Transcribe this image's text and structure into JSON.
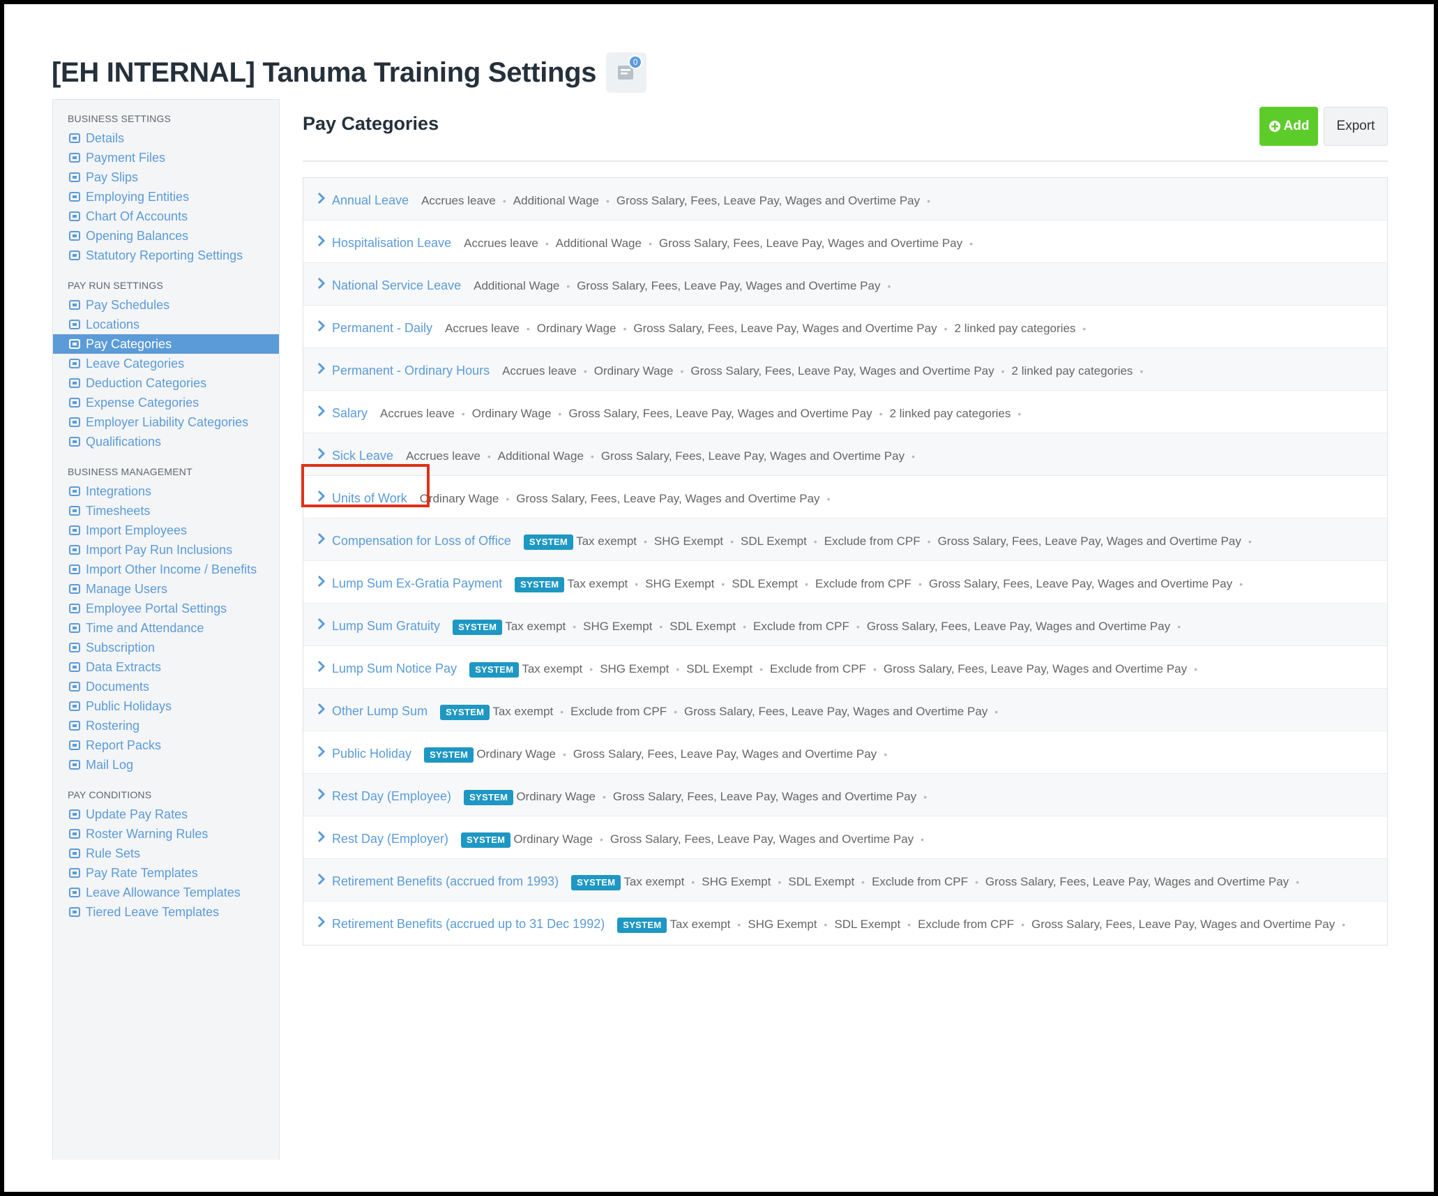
{
  "page": {
    "title": "[EH INTERNAL] Tanuma Training Settings",
    "notes_count": "0"
  },
  "sidebar": {
    "sections": [
      {
        "heading": "BUSINESS SETTINGS",
        "items": [
          {
            "label": "Details",
            "icon": "gear-icon"
          },
          {
            "label": "Payment Files",
            "icon": "floppy-icon"
          },
          {
            "label": "Pay Slips",
            "icon": "file-icon"
          },
          {
            "label": "Employing Entities",
            "icon": "bank-icon"
          },
          {
            "label": "Chart Of Accounts",
            "icon": "list-icon"
          },
          {
            "label": "Opening Balances",
            "icon": "leaf-icon"
          },
          {
            "label": "Statutory Reporting Settings",
            "icon": "lifebuoy-icon"
          }
        ]
      },
      {
        "heading": "PAY RUN SETTINGS",
        "items": [
          {
            "label": "Pay Schedules",
            "icon": "calendar-icon"
          },
          {
            "label": "Locations",
            "icon": "globe-icon"
          },
          {
            "label": "Pay Categories",
            "icon": "money-icon",
            "active": true
          },
          {
            "label": "Leave Categories",
            "icon": "plane-icon"
          },
          {
            "label": "Deduction Categories",
            "icon": "minus-circle-icon"
          },
          {
            "label": "Expense Categories",
            "icon": "archive-icon"
          },
          {
            "label": "Employer Liability Categories",
            "icon": "bar-chart-icon"
          },
          {
            "label": "Qualifications",
            "icon": "check-icon"
          }
        ]
      },
      {
        "heading": "BUSINESS MANAGEMENT",
        "items": [
          {
            "label": "Integrations",
            "icon": "integrations-icon"
          },
          {
            "label": "Timesheets",
            "icon": "clock-icon"
          },
          {
            "label": "Import Employees",
            "icon": "users-icon"
          },
          {
            "label": "Import Pay Run Inclusions",
            "icon": "refresh-icon"
          },
          {
            "label": "Import Other Income / Benefits",
            "icon": "hand-money-icon"
          },
          {
            "label": "Manage Users",
            "icon": "lock-icon"
          },
          {
            "label": "Employee Portal Settings",
            "icon": "wand-icon"
          },
          {
            "label": "Time and Attendance",
            "icon": "user-clock-icon"
          },
          {
            "label": "Subscription",
            "icon": "credit-card-icon"
          },
          {
            "label": "Data Extracts",
            "icon": "cloud-download-icon"
          },
          {
            "label": "Documents",
            "icon": "folder-icon"
          },
          {
            "label": "Public Holidays",
            "icon": "calendar-icon"
          },
          {
            "label": "Rostering",
            "icon": "calendar-icon"
          },
          {
            "label": "Report Packs",
            "icon": "folder-open-icon"
          },
          {
            "label": "Mail Log",
            "icon": "envelope-icon"
          }
        ]
      },
      {
        "heading": "PAY CONDITIONS",
        "items": [
          {
            "label": "Update Pay Rates",
            "icon": "hand-coins-icon"
          },
          {
            "label": "Roster Warning Rules",
            "icon": "calendar-warning-icon"
          },
          {
            "label": "Rule Sets",
            "icon": "gavel-icon"
          },
          {
            "label": "Pay Rate Templates",
            "icon": "money-icon"
          },
          {
            "label": "Leave Allowance Templates",
            "icon": "plane-icon"
          },
          {
            "label": "Tiered Leave Templates",
            "icon": "plane-icon"
          }
        ]
      }
    ]
  },
  "main": {
    "title": "Pay Categories",
    "add_label": "Add",
    "export_label": "Export",
    "system_badge": "SYSTEM",
    "categories": [
      {
        "name": "Annual Leave",
        "system": false,
        "props": [
          "Accrues leave",
          "Additional Wage",
          "Gross Salary, Fees, Leave Pay, Wages and Overtime Pay"
        ]
      },
      {
        "name": "Hospitalisation Leave",
        "system": false,
        "props": [
          "Accrues leave",
          "Additional Wage",
          "Gross Salary, Fees, Leave Pay, Wages and Overtime Pay"
        ]
      },
      {
        "name": "National Service Leave",
        "system": false,
        "props": [
          "Additional Wage",
          "Gross Salary, Fees, Leave Pay, Wages and Overtime Pay"
        ]
      },
      {
        "name": "Permanent - Daily",
        "system": false,
        "props": [
          "Accrues leave",
          "Ordinary Wage",
          "Gross Salary, Fees, Leave Pay, Wages and Overtime Pay",
          "2 linked pay categories"
        ]
      },
      {
        "name": "Permanent - Ordinary Hours",
        "system": false,
        "props": [
          "Accrues leave",
          "Ordinary Wage",
          "Gross Salary, Fees, Leave Pay, Wages and Overtime Pay",
          "2 linked pay categories"
        ]
      },
      {
        "name": "Salary",
        "system": false,
        "props": [
          "Accrues leave",
          "Ordinary Wage",
          "Gross Salary, Fees, Leave Pay, Wages and Overtime Pay",
          "2 linked pay categories"
        ]
      },
      {
        "name": "Sick Leave",
        "system": false,
        "props": [
          "Accrues leave",
          "Additional Wage",
          "Gross Salary, Fees, Leave Pay, Wages and Overtime Pay"
        ]
      },
      {
        "name": "Units of Work",
        "system": false,
        "props": [
          "Ordinary Wage",
          "Gross Salary, Fees, Leave Pay, Wages and Overtime Pay"
        ]
      },
      {
        "name": "Compensation for Loss of Office",
        "system": true,
        "props": [
          "Tax exempt",
          "SHG Exempt",
          "SDL Exempt",
          "Exclude from CPF",
          "Gross Salary, Fees, Leave Pay, Wages and Overtime Pay"
        ]
      },
      {
        "name": "Lump Sum Ex-Gratia Payment",
        "system": true,
        "props": [
          "Tax exempt",
          "SHG Exempt",
          "SDL Exempt",
          "Exclude from CPF",
          "Gross Salary, Fees, Leave Pay, Wages and Overtime Pay"
        ]
      },
      {
        "name": "Lump Sum Gratuity",
        "system": true,
        "props": [
          "Tax exempt",
          "SHG Exempt",
          "SDL Exempt",
          "Exclude from CPF",
          "Gross Salary, Fees, Leave Pay, Wages and Overtime Pay"
        ]
      },
      {
        "name": "Lump Sum Notice Pay",
        "system": true,
        "props": [
          "Tax exempt",
          "SHG Exempt",
          "SDL Exempt",
          "Exclude from CPF",
          "Gross Salary, Fees, Leave Pay, Wages and Overtime Pay"
        ]
      },
      {
        "name": "Other Lump Sum",
        "system": true,
        "props": [
          "Tax exempt",
          "Exclude from CPF",
          "Gross Salary, Fees, Leave Pay, Wages and Overtime Pay"
        ]
      },
      {
        "name": "Public Holiday",
        "system": true,
        "props": [
          "Ordinary Wage",
          "Gross Salary, Fees, Leave Pay, Wages and Overtime Pay"
        ]
      },
      {
        "name": "Rest Day (Employee)",
        "system": true,
        "props": [
          "Ordinary Wage",
          "Gross Salary, Fees, Leave Pay, Wages and Overtime Pay"
        ]
      },
      {
        "name": "Rest Day (Employer)",
        "system": true,
        "props": [
          "Ordinary Wage",
          "Gross Salary, Fees, Leave Pay, Wages and Overtime Pay"
        ]
      },
      {
        "name": "Retirement Benefits (accrued from 1993)",
        "system": true,
        "props": [
          "Tax exempt",
          "SHG Exempt",
          "SDL Exempt",
          "Exclude from CPF",
          "Gross Salary, Fees, Leave Pay, Wages and Overtime Pay"
        ]
      },
      {
        "name": "Retirement Benefits (accrued up to 31 Dec 1992)",
        "system": true,
        "props": [
          "Tax exempt",
          "SHG Exempt",
          "SDL Exempt",
          "Exclude from CPF",
          "Gross Salary, Fees, Leave Pay, Wages and Overtime Pay"
        ]
      }
    ]
  },
  "colors": {
    "link": "#5b9bd8",
    "add_button": "#5ccc2a",
    "system_badge": "#1e97c3",
    "highlight": "#e0311a"
  }
}
